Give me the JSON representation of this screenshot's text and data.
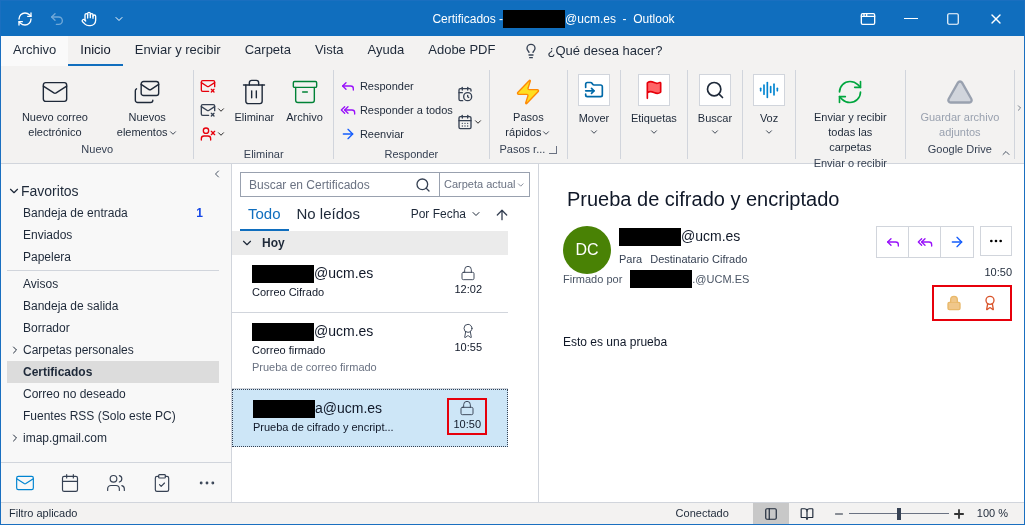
{
  "window": {
    "title_prefix": "Certificados - ",
    "title_suffix": "@ucm.es  -  Outlook"
  },
  "ribbon_tabs": [
    {
      "label": "Archivo",
      "selected": false,
      "kind": "file"
    },
    {
      "label": "Inicio",
      "selected": true,
      "kind": "tab"
    },
    {
      "label": "Enviar y recibir",
      "selected": false,
      "kind": "tab"
    },
    {
      "label": "Carpeta",
      "selected": false,
      "kind": "tab"
    },
    {
      "label": "Vista",
      "selected": false,
      "kind": "tab"
    },
    {
      "label": "Ayuda",
      "selected": false,
      "kind": "tab"
    },
    {
      "label": "Adobe PDF",
      "selected": false,
      "kind": "tab"
    }
  ],
  "tell_me": "¿Qué desea hacer?",
  "ribbon_groups": [
    {
      "label": "Nuevo",
      "buttons": [
        {
          "label": "Nuevo correo electrónico",
          "kind": "large",
          "dropdown": false
        },
        {
          "label": "Nuevos elementos",
          "kind": "large",
          "dropdown": true
        }
      ]
    },
    {
      "label": "Eliminar",
      "buttons": [
        {
          "kind": "icon",
          "dropdown": false
        },
        {
          "kind": "icon",
          "dropdown": true
        },
        {
          "kind": "icon",
          "dropdown": true
        },
        {
          "label": "Eliminar",
          "kind": "large",
          "dropdown": false
        },
        {
          "label": "Archivo",
          "kind": "large",
          "dropdown": false
        }
      ]
    },
    {
      "label": "Responder",
      "buttons": [
        {
          "label": "Responder",
          "kind": "small",
          "dropdown": false
        },
        {
          "label": "Responder a todos",
          "kind": "small",
          "dropdown": false
        },
        {
          "label": "Reenviar",
          "kind": "small",
          "dropdown": false
        },
        {
          "kind": "icon",
          "dropdown": false
        },
        {
          "kind": "icon",
          "dropdown": true
        }
      ]
    },
    {
      "label": "Pasos r...",
      "launcher": true,
      "buttons": [
        {
          "label": "Pasos rápidos",
          "kind": "large",
          "dropdown": true
        }
      ]
    },
    {
      "buttons": [
        {
          "label": "Mover",
          "kind": "boxed",
          "dropdown": true
        }
      ]
    },
    {
      "buttons": [
        {
          "label": "Etiquetas",
          "kind": "boxed",
          "dropdown": true
        }
      ]
    },
    {
      "buttons": [
        {
          "label": "Buscar",
          "kind": "boxed",
          "dropdown": true
        }
      ]
    },
    {
      "buttons": [
        {
          "label": "Voz",
          "kind": "boxed",
          "dropdown": true
        }
      ]
    },
    {
      "label": "Enviar o recibir",
      "buttons": [
        {
          "label": "Enviar y recibir todas las carpetas",
          "kind": "large",
          "dropdown": false
        }
      ]
    },
    {
      "label": "Google Drive",
      "buttons": [
        {
          "label": "Guardar archivo adjuntos",
          "kind": "large",
          "dropdown": false,
          "disabled": true
        }
      ]
    }
  ],
  "sidebar": {
    "favorites": {
      "label": "Favoritos",
      "expanded": true,
      "children": [
        {
          "label": "Bandeja de entrada",
          "count": "1",
          "selected": false
        },
        {
          "label": "Enviados",
          "selected": false
        },
        {
          "label": "Papelera",
          "selected": false
        }
      ]
    },
    "folders": [
      {
        "label": "Avisos",
        "selected": false
      },
      {
        "label": "Bandeja de salida",
        "selected": false
      },
      {
        "label": "Borrador",
        "selected": false
      },
      {
        "label": "Carpetas personales",
        "selected": false,
        "expanded": false
      },
      {
        "label": "Certificados",
        "selected": true
      },
      {
        "label": "Correo no deseado",
        "selected": false
      },
      {
        "label": "Fuentes RSS (Solo este PC)",
        "selected": false
      },
      {
        "label": "imap.gmail.com",
        "selected": false,
        "expanded": false
      }
    ],
    "nav": [
      {
        "kind": "mail",
        "selected": true
      },
      {
        "kind": "calendar",
        "selected": false
      },
      {
        "kind": "people",
        "selected": false
      },
      {
        "kind": "tasks",
        "selected": false
      },
      {
        "kind": "more",
        "selected": false
      }
    ]
  },
  "message_list": {
    "search_placeholder": "Buscar en Certificados",
    "scope": "Carpeta actual",
    "filters": [
      {
        "label": "Todo",
        "selected": true
      },
      {
        "label": "No leídos",
        "selected": false
      }
    ],
    "sort": "Por Fecha",
    "group": {
      "label": "Hoy",
      "expanded": true
    },
    "messages": [
      {
        "sender": "@ucm.es",
        "subject": "Correo Cifrado",
        "time": "12:02",
        "kind": "encrypted",
        "selected": false,
        "highlighted": false
      },
      {
        "sender": "@ucm.es",
        "subject": "Correo firmado",
        "preview": "Prueba de correo firmado",
        "time": "10:55",
        "kind": "signed",
        "selected": false,
        "highlighted": false
      },
      {
        "sender": "a@ucm.es",
        "subject": "Prueba de cifrado y encript...",
        "time": "10:50",
        "kind": "encrypted",
        "selected": true,
        "highlighted": true
      }
    ]
  },
  "reading_pane": {
    "subject": "Prueba de cifrado y encriptado",
    "initials": "DC",
    "sender": "@ucm.es",
    "to_label": "Para",
    "to": "Destinatario Cifrado",
    "signed_label": "Firmado por",
    "signed_by": ".@UCM.ES",
    "time": "10:50",
    "security_highlighted": true,
    "body": "Esto es una prueba"
  },
  "status_bar": {
    "left": "Filtro aplicado",
    "connection": "Conectado",
    "zoom": "100 %",
    "zoom_slider": {
      "level": 0.5
    }
  }
}
